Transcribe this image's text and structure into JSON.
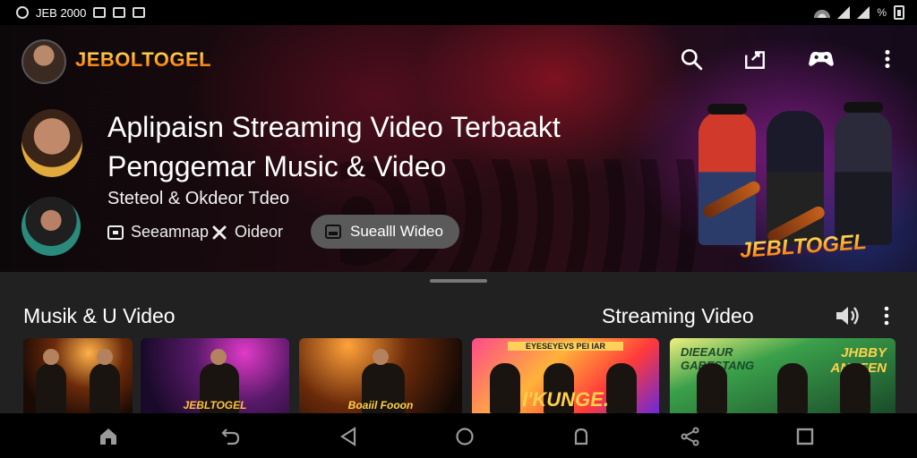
{
  "status_bar": {
    "time": "JEB 2000",
    "battery": "%"
  },
  "header": {
    "channel_name": "JEBOLTOGEL",
    "actions": [
      {
        "name": "search-icon"
      },
      {
        "name": "cast-icon"
      },
      {
        "name": "gamepad-icon"
      },
      {
        "name": "more-vertical-icon"
      }
    ]
  },
  "hero": {
    "title_line1": "Aplipaisn Streaming Video Terbaakt",
    "title_line2": "Penggemar Music & Video",
    "subtitle": "Steteol & Okdeor Tdeo",
    "meta_left": "Seeamnap",
    "meta_right": "Oideor",
    "pill_label": "Suealll Wideo",
    "poster_brand": "JEBLTOGEL"
  },
  "section": {
    "left_title": "Musik & U Video",
    "right_title": "Streaming Video"
  },
  "thumbnails": [
    {
      "label": ""
    },
    {
      "label": "JEBLTOGEL"
    },
    {
      "label": "Boaiil Fooon"
    },
    {
      "label": "I'KUNGE."
    },
    {
      "label": "JHBBY ANAFEN"
    }
  ],
  "thumbnail_tops": [
    {
      "label": ""
    },
    {
      "label": ""
    },
    {
      "label": ""
    },
    {
      "label": "EYESEYEVS PEI IAR"
    },
    {
      "label": "DIEEAUR GABESTANG"
    }
  ],
  "navbar": {
    "buttons": [
      "home-icon",
      "back-icon",
      "triangle-back-icon",
      "circle-home-icon",
      "bell-icon",
      "share-icon",
      "square-recents-icon"
    ]
  },
  "colors": {
    "accent_gold": "#ffb21a",
    "pill_bg": "#5a5a5a",
    "lower_bg": "#212121"
  }
}
